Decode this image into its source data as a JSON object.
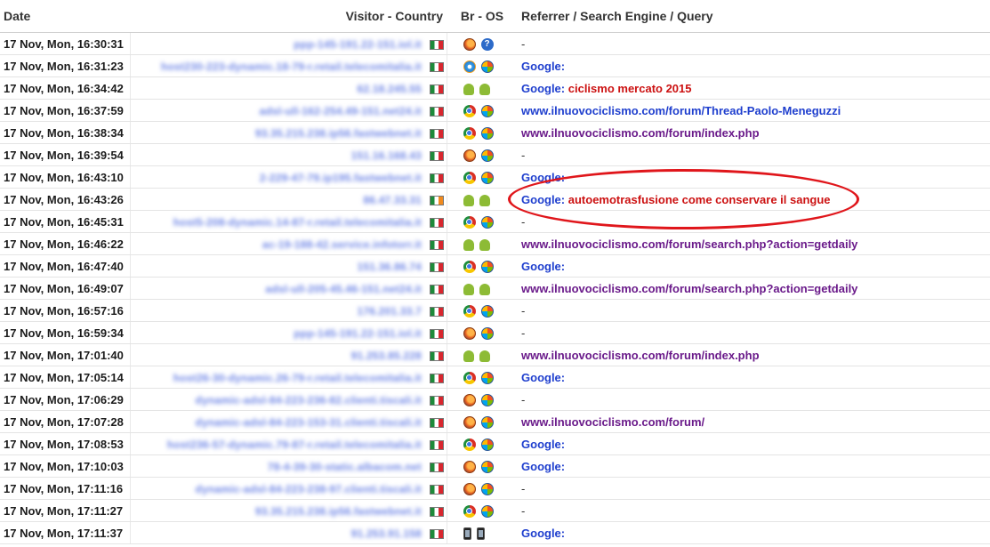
{
  "headers": {
    "date": "Date",
    "visitor": "Visitor - Country",
    "br_os": "Br - OS",
    "referrer": "Referrer / Search Engine / Query"
  },
  "rows": [
    {
      "date": "17 Nov, Mon, 16:30:31",
      "host": "ppp-145-191.22-151.iol.it",
      "flag": "it",
      "browser": "firefox",
      "os": "unknown",
      "ref_type": "dash",
      "ref_text": "-",
      "query": ""
    },
    {
      "date": "17 Nov, Mon, 16:31:23",
      "host": "host230-223-dynamic.18-79-r.retail.telecomitalia.it",
      "flag": "it",
      "browser": "ie",
      "os": "windows",
      "ref_type": "google",
      "ref_text": "Google:",
      "query": ""
    },
    {
      "date": "17 Nov, Mon, 16:34:42",
      "host": "62.18.245.55",
      "flag": "it",
      "browser": "android",
      "os": "android",
      "ref_type": "google",
      "ref_text": "Google:",
      "query": "ciclismo mercato 2015"
    },
    {
      "date": "17 Nov, Mon, 16:37:59",
      "host": "adsl-ull-162-254.49-151.net24.it",
      "flag": "it",
      "browser": "chrome",
      "os": "windows",
      "ref_type": "link-blue",
      "ref_text": "www.ilnuovociclismo.com/forum/Thread-Paolo-Meneguzzi",
      "query": ""
    },
    {
      "date": "17 Nov, Mon, 16:38:34",
      "host": "93.35.215.238.ip56.fastwebnet.it",
      "flag": "it",
      "browser": "chrome",
      "os": "windows",
      "ref_type": "link-purple",
      "ref_text": "www.ilnuovociclismo.com/forum/index.php",
      "query": ""
    },
    {
      "date": "17 Nov, Mon, 16:39:54",
      "host": "151.16.168.43",
      "flag": "it",
      "browser": "firefox",
      "os": "windows",
      "ref_type": "dash",
      "ref_text": "-",
      "query": ""
    },
    {
      "date": "17 Nov, Mon, 16:43:10",
      "host": "2-229-47-79.ip195.fastwebnet.it",
      "flag": "it",
      "browser": "chrome",
      "os": "windows",
      "ref_type": "google",
      "ref_text": "Google:",
      "query": ""
    },
    {
      "date": "17 Nov, Mon, 16:43:26",
      "host": "86.47.33.31",
      "flag": "ie",
      "browser": "android",
      "os": "android",
      "ref_type": "google",
      "ref_text": "Google:",
      "query": "autoemotrasfusione come conservare il sangue"
    },
    {
      "date": "17 Nov, Mon, 16:45:31",
      "host": "host5-208-dynamic.14-87-r.retail.telecomitalia.it",
      "flag": "it",
      "browser": "chrome",
      "os": "windows",
      "ref_type": "dash",
      "ref_text": "-",
      "query": ""
    },
    {
      "date": "17 Nov, Mon, 16:46:22",
      "host": "ac-19-188-42.service.infotorr.it",
      "flag": "it",
      "browser": "android",
      "os": "android",
      "ref_type": "link-purple",
      "ref_text": "www.ilnuovociclismo.com/forum/search.php?action=getdaily",
      "query": ""
    },
    {
      "date": "17 Nov, Mon, 16:47:40",
      "host": "151.36.86.74",
      "flag": "it",
      "browser": "chrome",
      "os": "windows",
      "ref_type": "google",
      "ref_text": "Google:",
      "query": ""
    },
    {
      "date": "17 Nov, Mon, 16:49:07",
      "host": "adsl-ull-205-45.46-151.net24.it",
      "flag": "it",
      "browser": "android",
      "os": "android",
      "ref_type": "link-purple",
      "ref_text": "www.ilnuovociclismo.com/forum/search.php?action=getdaily",
      "query": ""
    },
    {
      "date": "17 Nov, Mon, 16:57:16",
      "host": "176.201.33.7",
      "flag": "it",
      "browser": "chrome",
      "os": "windows",
      "ref_type": "dash",
      "ref_text": "-",
      "query": ""
    },
    {
      "date": "17 Nov, Mon, 16:59:34",
      "host": "ppp-145-191.22-151.iol.it",
      "flag": "it",
      "browser": "firefox",
      "os": "windows",
      "ref_type": "dash",
      "ref_text": "-",
      "query": ""
    },
    {
      "date": "17 Nov, Mon, 17:01:40",
      "host": "91.253.85.228",
      "flag": "it",
      "browser": "android",
      "os": "android",
      "ref_type": "link-purple",
      "ref_text": "www.ilnuovociclismo.com/forum/index.php",
      "query": ""
    },
    {
      "date": "17 Nov, Mon, 17:05:14",
      "host": "host26-30-dynamic.26-79-r.retail.telecomitalia.it",
      "flag": "it",
      "browser": "chrome",
      "os": "windows",
      "ref_type": "google",
      "ref_text": "Google:",
      "query": ""
    },
    {
      "date": "17 Nov, Mon, 17:06:29",
      "host": "dynamic-adsl-84-223-236-82.clienti.tiscali.it",
      "flag": "it",
      "browser": "firefox",
      "os": "windows",
      "ref_type": "dash",
      "ref_text": "-",
      "query": ""
    },
    {
      "date": "17 Nov, Mon, 17:07:28",
      "host": "dynamic-adsl-84-223-153-31.clienti.tiscali.it",
      "flag": "it",
      "browser": "firefox",
      "os": "windows",
      "ref_type": "link-purple",
      "ref_text": "www.ilnuovociclismo.com/forum/",
      "query": ""
    },
    {
      "date": "17 Nov, Mon, 17:08:53",
      "host": "host236-57-dynamic.79-87-r.retail.telecomitalia.it",
      "flag": "it",
      "browser": "chrome",
      "os": "windows",
      "ref_type": "google",
      "ref_text": "Google:",
      "query": ""
    },
    {
      "date": "17 Nov, Mon, 17:10:03",
      "host": "78-4-39-30-static.albacom.net",
      "flag": "it",
      "browser": "firefox",
      "os": "windows",
      "ref_type": "google",
      "ref_text": "Google:",
      "query": ""
    },
    {
      "date": "17 Nov, Mon, 17:11:16",
      "host": "dynamic-adsl-84-223-238-97.clienti.tiscali.it",
      "flag": "it",
      "browser": "firefox",
      "os": "windows",
      "ref_type": "dash",
      "ref_text": "-",
      "query": ""
    },
    {
      "date": "17 Nov, Mon, 17:11:27",
      "host": "93.35.215.238.ip56.fastwebnet.it",
      "flag": "it",
      "browser": "chrome",
      "os": "windows",
      "ref_type": "dash",
      "ref_text": "-",
      "query": ""
    },
    {
      "date": "17 Nov, Mon, 17:11:37",
      "host": "91.253.91.158",
      "flag": "it",
      "browser": "mobile",
      "os": "mobile",
      "ref_type": "google",
      "ref_text": "Google:",
      "query": ""
    }
  ]
}
